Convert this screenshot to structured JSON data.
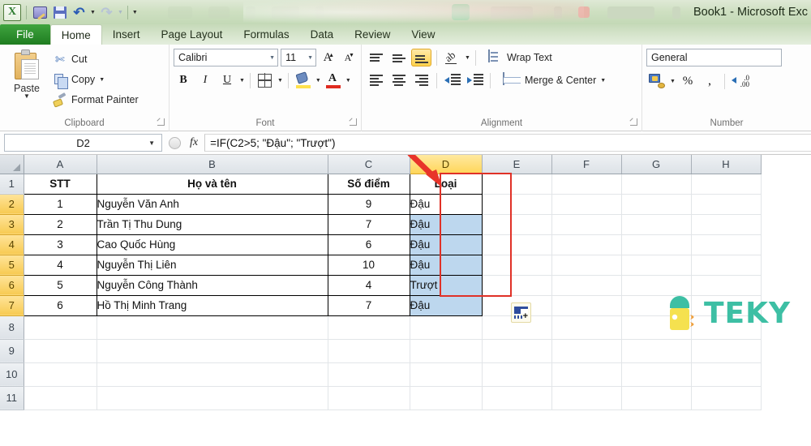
{
  "window": {
    "title": "Book1  -  Microsoft Exc",
    "qat": [
      {
        "name": "excel-logo",
        "glyph": "X"
      },
      {
        "name": "customize-tool-icon"
      },
      {
        "name": "save-icon"
      },
      {
        "name": "undo-icon"
      },
      {
        "name": "redo-icon"
      },
      {
        "name": "customize-qat-icon"
      }
    ]
  },
  "ribbon": {
    "tabs": [
      {
        "label": "File",
        "active": false,
        "file": true
      },
      {
        "label": "Home",
        "active": true
      },
      {
        "label": "Insert",
        "active": false
      },
      {
        "label": "Page Layout",
        "active": false
      },
      {
        "label": "Formulas",
        "active": false
      },
      {
        "label": "Data",
        "active": false
      },
      {
        "label": "Review",
        "active": false
      },
      {
        "label": "View",
        "active": false
      }
    ],
    "groups": {
      "clipboard": {
        "label": "Clipboard",
        "paste": "Paste",
        "cut": "Cut",
        "copy": "Copy",
        "format_painter": "Format Painter"
      },
      "font": {
        "label": "Font",
        "font_name": "Calibri",
        "font_size": "11",
        "bold": "B",
        "italic": "I",
        "underline": "U",
        "grow_font": "A",
        "shrink_font": "A"
      },
      "alignment": {
        "label": "Alignment",
        "wrap_text": "Wrap Text",
        "merge_center": "Merge & Center"
      },
      "number": {
        "label": "Number",
        "format": "General",
        "percent": "%",
        "comma": ","
      }
    }
  },
  "formula_bar": {
    "name_box": "D2",
    "formula": "=IF(C2>5; \"Đậu\"; \"Trượt\")",
    "fx_label": "fx"
  },
  "sheet": {
    "columns": [
      "A",
      "B",
      "C",
      "D",
      "E",
      "F",
      "G",
      "H"
    ],
    "selected_column": "D",
    "rows": [
      "1",
      "2",
      "3",
      "4",
      "5",
      "6",
      "7",
      "8",
      "9",
      "10",
      "11"
    ],
    "selected_rows": [
      "2",
      "3",
      "4",
      "5",
      "6",
      "7"
    ],
    "header_row": [
      "STT",
      "Họ và tên",
      "Số điểm",
      "Loại"
    ],
    "data_rows": [
      {
        "stt": "1",
        "name": "Nguyễn Văn Anh",
        "score": "9",
        "result": "Đậu"
      },
      {
        "stt": "2",
        "name": "Trần Tị Thu Dung",
        "score": "7",
        "result": "Đậu"
      },
      {
        "stt": "3",
        "name": "Cao Quốc Hùng",
        "score": "6",
        "result": "Đậu"
      },
      {
        "stt": "4",
        "name": "Nguyễn Thị Liên",
        "score": "10",
        "result": "Đậu"
      },
      {
        "stt": "5",
        "name": "Nguyễn Công Thành",
        "score": "4",
        "result": "Trượt"
      },
      {
        "stt": "6",
        "name": "Hồ Thị Minh Trang",
        "score": "7",
        "result": "Đậu"
      }
    ]
  },
  "annotations": {
    "arrow_color": "#e8342a",
    "selection_rect_color": "#e03127",
    "autofill_tag": "auto-fill-options"
  },
  "watermark": {
    "text": "TEKY",
    "color": "#3dbfa4",
    "body_color": "#f5e14f",
    "accent_color": "#f0a03c"
  },
  "colors": {
    "selected_header": "#ffd659",
    "selected_cells": "#bdd7ee",
    "tab_green": "#2f8f2f"
  }
}
